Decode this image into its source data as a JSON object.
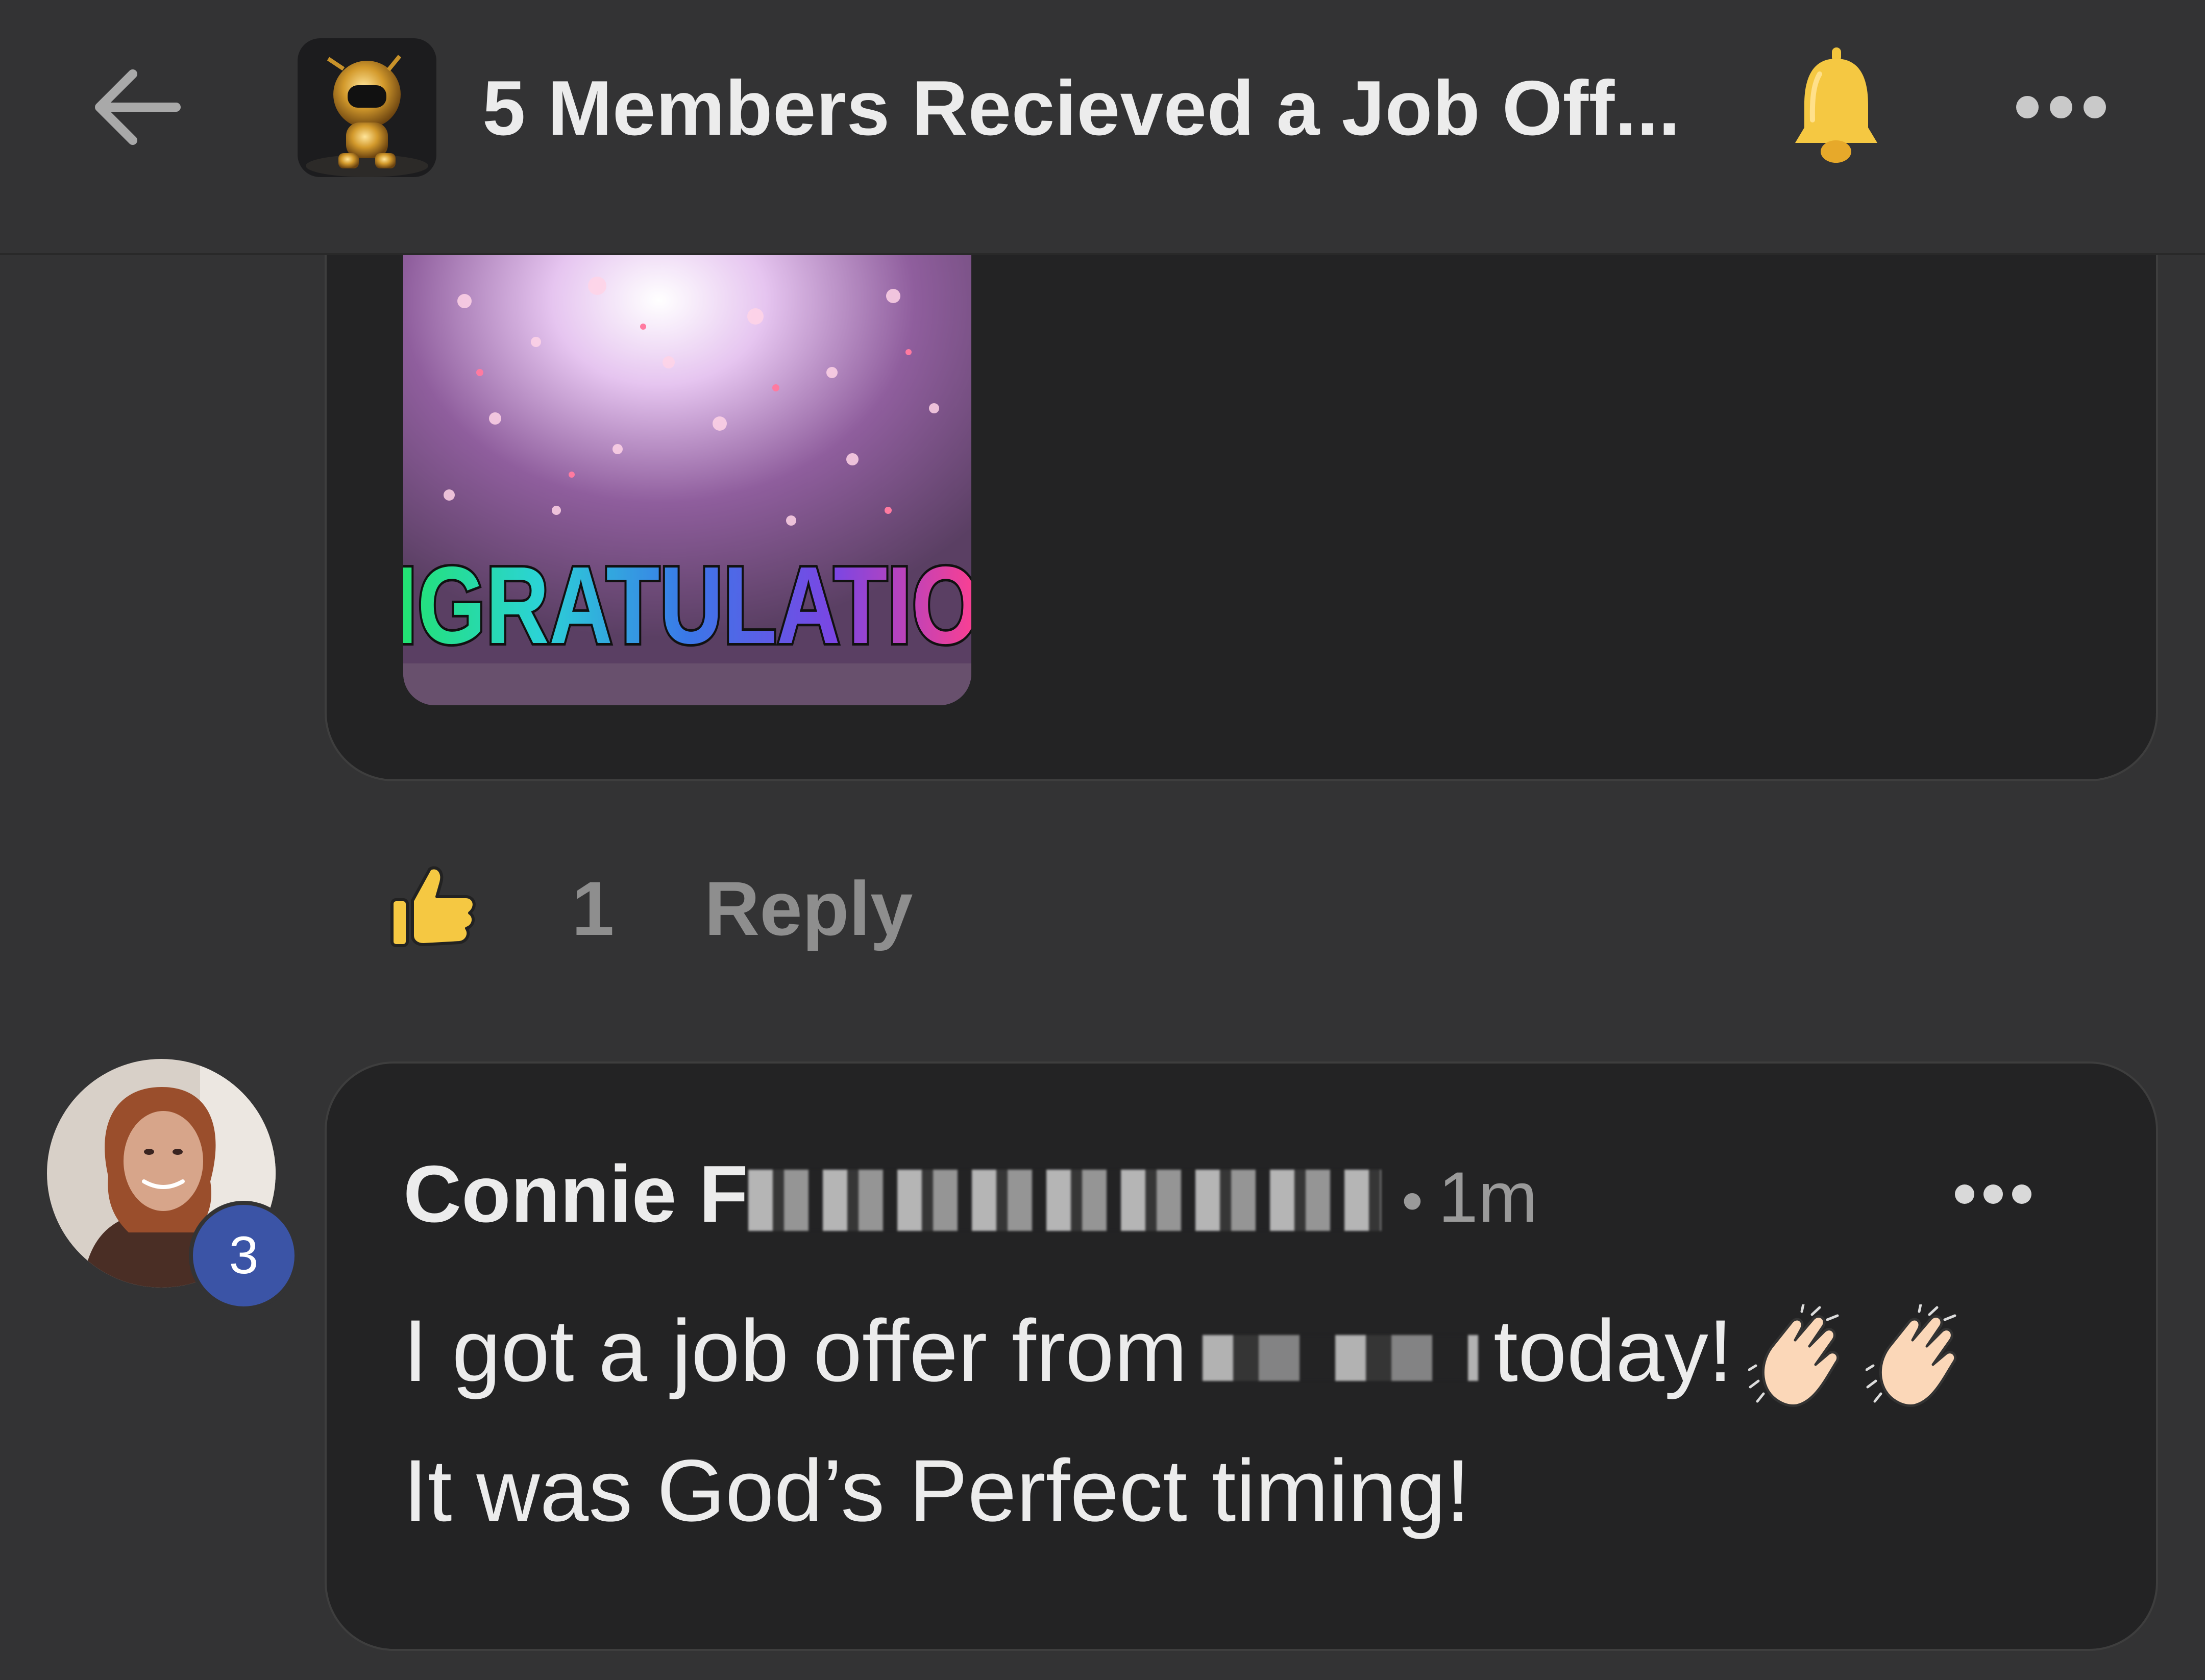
{
  "header": {
    "title": "5 Members Recieved a Job Off...",
    "back_icon": "arrow-left-icon",
    "bell_icon": "bell-icon",
    "more_icon": "more-horizontal-icon",
    "bell_color": "#f2c53d"
  },
  "gif_comment": {
    "gif_text": "IGRATULATIO",
    "like_count": "1",
    "reply_label": "Reply",
    "like_icon": "thumbs-up-icon"
  },
  "comment": {
    "author": "Connie F",
    "badge": "3",
    "separator": "•",
    "time": "1m",
    "line1_start": "I got a job offer from",
    "line1_end": "today!",
    "line2": "It was God’s Perfect timing!",
    "emoji_icon": "clapping-hands-icon",
    "badge_color": "#3b54a6"
  }
}
